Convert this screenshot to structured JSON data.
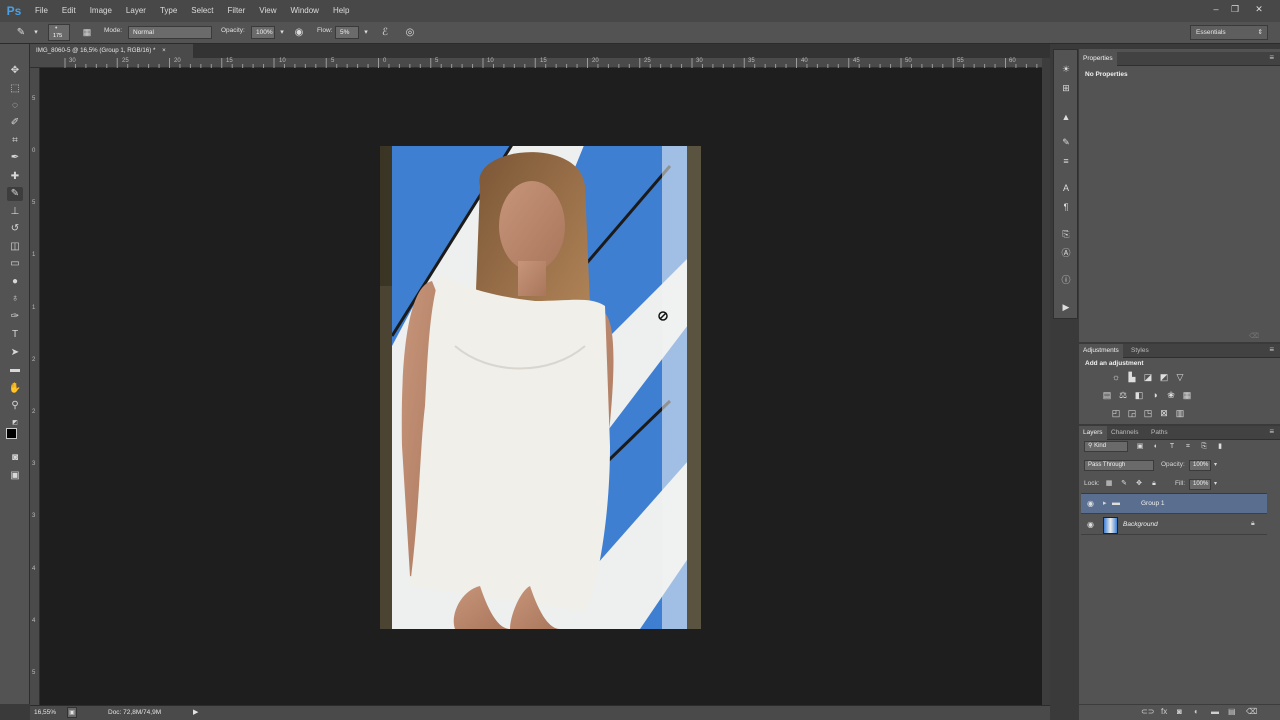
{
  "app": {
    "logo": "Ps"
  },
  "menu": [
    "File",
    "Edit",
    "Image",
    "Layer",
    "Type",
    "Select",
    "Filter",
    "View",
    "Window",
    "Help"
  ],
  "window_controls": {
    "minimize": "–",
    "restore": "❐",
    "close": "✕"
  },
  "options": {
    "brush_size": "175",
    "mode_label": "Mode:",
    "mode_value": "Normal",
    "opacity_label": "Opacity:",
    "opacity_value": "100%",
    "flow_label": "Flow:",
    "flow_value": "5%",
    "workspace": "Essentials"
  },
  "document": {
    "tab_title": "IMG_8060-5 @ 16,5% (Group 1, RGB/16) *",
    "tab_close": "×",
    "zoom": "16,55%",
    "doc_size": "Doc: 72,8M/74,9M"
  },
  "rulers": {
    "top": [
      "30",
      "25",
      "20",
      "15",
      "10",
      "5",
      "0",
      "5",
      "10",
      "15",
      "20",
      "25",
      "30",
      "35",
      "40",
      "45",
      "50",
      "55",
      "60"
    ],
    "left": [
      "5",
      "0",
      "5",
      "1",
      "1",
      "2",
      "2",
      "3",
      "3",
      "4",
      "4",
      "5"
    ]
  },
  "properties": {
    "tab": "Properties",
    "content": "No Properties"
  },
  "adjustments": {
    "tabs": [
      "Adjustments",
      "Styles"
    ],
    "heading": "Add an adjustment",
    "icons_row1": [
      "brightness-icon",
      "levels-icon",
      "curves-icon",
      "exposure-icon",
      "vibrance-icon"
    ],
    "icons_row2": [
      "hue-saturation-icon",
      "color-balance-icon",
      "black-white-icon",
      "photo-filter-icon",
      "channel-mixer-icon",
      "color-lookup-icon"
    ],
    "icons_row3": [
      "invert-icon",
      "posterize-icon",
      "threshold-icon",
      "selective-color-icon",
      "gradient-map-icon"
    ]
  },
  "layers": {
    "tabs": [
      "Layers",
      "Channels",
      "Paths"
    ],
    "filter_kind": "Kind",
    "blend_mode": "Pass Through",
    "opacity_label": "Opacity:",
    "opacity_value": "100%",
    "lock_label": "Lock:",
    "fill_label": "Fill:",
    "fill_value": "100%",
    "items": [
      {
        "name": "Group 1",
        "type": "group",
        "selected": true
      },
      {
        "name": "Background",
        "type": "image",
        "locked": true
      }
    ]
  },
  "colors": {
    "accent": "#4aa0e6",
    "selected_layer": "#5a6f8f",
    "canvas_bg": "#1e1e1e",
    "panel_bg": "#535353"
  }
}
